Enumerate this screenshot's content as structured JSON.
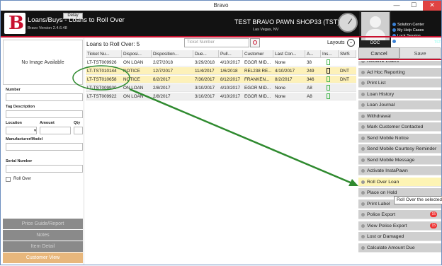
{
  "window": {
    "title": "Bravo",
    "minimize": "—",
    "maximize": "☐",
    "close": "✕"
  },
  "header": {
    "app_title": "Loans/Buys - Loans to Roll Over",
    "version": "Bravo Version 2.4.6.48",
    "delay_label": "Delay",
    "store_name": "TEST BRAVO PAWN SHOP33 (TST)",
    "store_location": "Las Vegas, NV",
    "user_label": "DOC",
    "links": [
      "Solution Center",
      "My Help Cases",
      "Lock Session",
      "Time Clock"
    ],
    "tst_label": "TST"
  },
  "left_panel": {
    "no_image": "No Image Available",
    "number_label": "Number",
    "tag_desc_label": "Tag Description",
    "location_label": "Location",
    "amount_label": "Amount",
    "qty_label": "Qty",
    "manufacturer_label": "Manufacturer/Model",
    "serial_label": "Serial Number",
    "rollover_label": "Roll Over",
    "buttons": [
      "Price Guide/Report",
      "Notes",
      "Item Detail",
      "Customer View"
    ]
  },
  "center": {
    "title": "Loans to Roll Over: 5",
    "search_placeholder": "Ticket Number",
    "layouts_label": "Layouts",
    "columns": [
      "Ticket Nu...",
      "Disposi...",
      "Disposition...",
      "Due...",
      "Pull...",
      "Customer",
      "Last Con...",
      "A...",
      "Ins...",
      "SMS"
    ],
    "rows": [
      [
        "LT-TST009926",
        "ON LOAN",
        "2/27/2018",
        "3/29/2018",
        "4/10/2017",
        "EGOR MID...",
        "None",
        "38",
        "",
        "SMS"
      ],
      [
        "LT-TST010144",
        "NOTICE",
        "12/7/2017",
        "11/4/2017",
        "1/6/2018",
        "REL238 RE...",
        "4/10/2017",
        "249",
        "",
        "DNT"
      ],
      [
        "LT-TST010658",
        "NOTICE",
        "8/2/2017",
        "7/30/2017",
        "8/12/2017",
        "FRANKEN...",
        "8/2/2017",
        "346",
        "",
        "DNT"
      ],
      [
        "LT-TST009930",
        "ON LOAN",
        "2/8/2017",
        "3/10/2017",
        "4/10/2017",
        "EGOR MID...",
        "None",
        "A8",
        "",
        "SMS"
      ],
      [
        "LT-TST009922",
        "ON LOAN",
        "2/8/2017",
        "3/10/2017",
        "4/10/2017",
        "EGOR MID...",
        "None",
        "A8",
        "",
        "SMS"
      ]
    ]
  },
  "right_panel": {
    "cancel_label": "Cancel",
    "save_label": "Save",
    "actions": [
      {
        "label": "Receive Loans",
        "badge": ""
      },
      {
        "label": "Ad Hoc Reporting",
        "badge": ""
      },
      {
        "label": "Print List",
        "badge": ""
      },
      {
        "label": "Loan History",
        "badge": ""
      },
      {
        "label": "Loan Journal",
        "badge": ""
      },
      {
        "label": "Withdrawal",
        "badge": ""
      },
      {
        "label": "Mark Customer Contacted",
        "badge": ""
      },
      {
        "label": "Send Mobile Notice",
        "badge": ""
      },
      {
        "label": "Send Mobile Courtesy Reminder",
        "badge": ""
      },
      {
        "label": "Send Mobile Message",
        "badge": ""
      },
      {
        "label": "Activate InstaPawn",
        "badge": ""
      },
      {
        "label": "Roll Over Loan",
        "badge": ""
      },
      {
        "label": "Place on Hold",
        "badge": ""
      },
      {
        "label": "Print Label",
        "badge": ""
      },
      {
        "label": "Police Export",
        "badge": "15"
      },
      {
        "label": "View Police Export",
        "badge": "15"
      },
      {
        "label": "Lost or Damaged",
        "badge": ""
      },
      {
        "label": "Calculate Amount Due",
        "badge": ""
      }
    ],
    "tooltip": "Roll Over the selected"
  },
  "colors": {
    "brand_red": "#c8102e",
    "highlight_yellow": "#fdf1b9",
    "annotation_green": "#2f8a2f"
  }
}
